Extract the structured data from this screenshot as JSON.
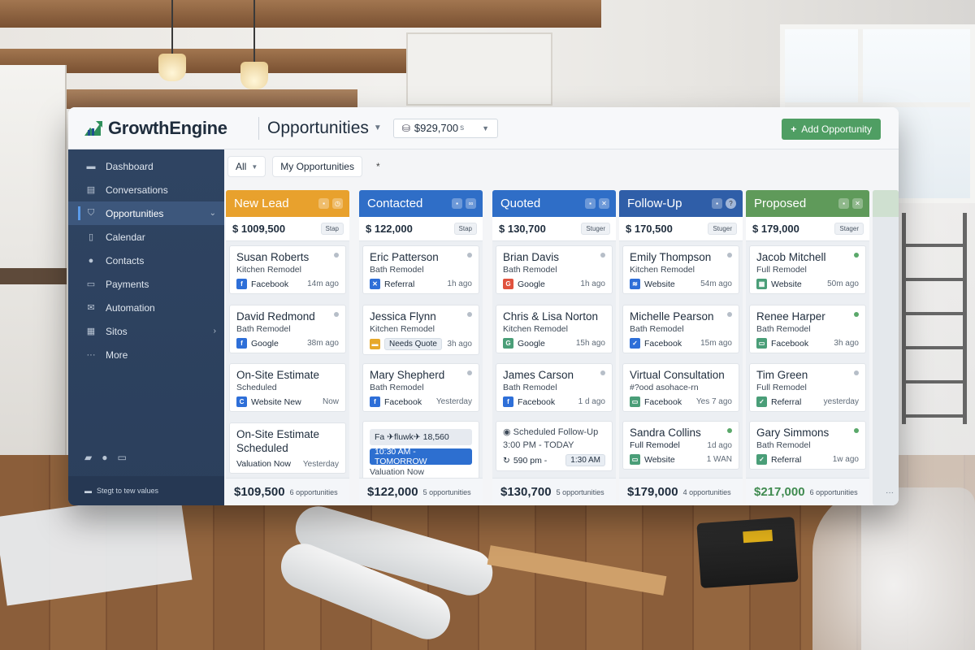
{
  "app": {
    "brand": "GrowthEngine",
    "page_title": "Opportunities",
    "pipeline_total": "$929,700",
    "pipeline_total_suffix": "s",
    "add_button": "Add Opportunity",
    "colors": {
      "accent_green": "#4f9e63",
      "sidebar_bg": "#2f4462",
      "active_blue": "#2d6fd0"
    }
  },
  "sidebar": {
    "items": [
      {
        "label": "Dashboard",
        "icon": "dashboard-icon"
      },
      {
        "label": "Conversations",
        "icon": "chat-icon"
      },
      {
        "label": "Opportunities",
        "icon": "filter-icon",
        "active": true
      },
      {
        "label": "Calendar",
        "icon": "calendar-icon"
      },
      {
        "label": "Contacts",
        "icon": "contacts-icon"
      },
      {
        "label": "Payments",
        "icon": "payments-icon"
      },
      {
        "label": "Automation",
        "icon": "automation-icon"
      },
      {
        "label": "Sitos",
        "icon": "sites-icon"
      },
      {
        "label": "More",
        "icon": "more-icon"
      }
    ],
    "footer": "Stegt to tew values"
  },
  "filters": {
    "all_label": "All",
    "my_label": "My Opportunities",
    "star": "*"
  },
  "columns": [
    {
      "title": "New Lead",
      "color": "#e8a12d",
      "total": "$ 1009,500",
      "stage_label": "Stap",
      "cards": [
        {
          "name": "Susan Roberts",
          "sub": "Kitchen Remodel",
          "source": "Facebook",
          "source_icon": "facebook-icon",
          "source_color": "#2e6fd8",
          "time": "14m ago"
        },
        {
          "name": "David Redmond",
          "sub": "Bath Remodel",
          "source": "Google",
          "source_icon": "facebook-icon",
          "source_color": "#2e6fd8",
          "time": "38m ago"
        },
        {
          "name": "On-Site Estimate",
          "sub": "Scheduled",
          "source": "Website New",
          "source_icon": "website-icon",
          "source_color": "#2e6fd8",
          "time": "Now"
        },
        {
          "name": "On-Site Estimate Scheduled",
          "sub": "",
          "source": "Valuation Now",
          "time": "Yesterday"
        }
      ],
      "footer_total": "$109,500",
      "footer_count": "6 opportunities"
    },
    {
      "title": "Contacted",
      "color": "#2f6ec7",
      "total": "$ 122,000",
      "stage_label": "Stap",
      "cards": [
        {
          "name": "Eric Patterson",
          "sub": "Bath Remodel",
          "source": "Referral",
          "source_icon": "referral-icon",
          "source_color": "#2e6fd8",
          "time": "1h ago"
        },
        {
          "name": "Jessica Flynn",
          "sub": "Kitchen Remodel",
          "source": "Needs Quote",
          "source_icon": "note-icon",
          "source_color": "#e6a82a",
          "time": "3h ago"
        },
        {
          "name": "Mary Shepherd",
          "sub": "Bath Remodel",
          "source": "Facebook",
          "source_icon": "facebook-icon",
          "source_color": "#2e6fd8",
          "time": "Yesterday"
        },
        {
          "name": "Fa ✈fluwk✈ 18,560",
          "time_bar": "10:30 AM - TOMORROW",
          "source": "Valuation Now"
        }
      ],
      "footer_total": "$122,000",
      "footer_count": "5 opportunities"
    },
    {
      "title": "Quoted",
      "color": "#2f6ec7",
      "total": "$ 130,700",
      "stage_label": "Stuger",
      "cards": [
        {
          "name": "Brian Davis",
          "sub": "Bath Remodel",
          "source": "Google",
          "source_icon": "google-icon",
          "source_color": "#e0523e",
          "time": "1h ago"
        },
        {
          "name": "Chris & Lisa Norton",
          "sub": "Kitchen Remodel",
          "source": "Google",
          "source_icon": "google-icon",
          "source_color": "#4a9e78",
          "time": "15h ago"
        },
        {
          "name": "James Carson",
          "sub": "Bath Remodel",
          "source": "Facebook",
          "source_icon": "facebook-icon",
          "source_color": "#2e6fd8",
          "time": "1 d ago"
        },
        {
          "name": "Scheduled Follow-Up",
          "sub": "3:00 PM - TODAY",
          "source": "590 pm -",
          "time_chip": "1:30 AM"
        }
      ],
      "footer_total": "$130,700",
      "footer_count": "5 opportunities"
    },
    {
      "title": "Follow-Up",
      "color": "#2f5ea8",
      "total": "$ 170,500",
      "stage_label": "Stuger",
      "cards": [
        {
          "name": "Emily Thompson",
          "sub": "Kitchen Remodel",
          "source": "Website",
          "source_icon": "website-icon",
          "source_color": "#2e6fd8",
          "time": "54m ago"
        },
        {
          "name": "Michelle Pearson",
          "sub": "Bath Remodel",
          "source": "Facebook",
          "source_icon": "facebook-icon",
          "source_color": "#2e6fd8",
          "time": "15m ago"
        },
        {
          "name": "Virtual Consultation",
          "sub": "#?ood asohace-rn",
          "source": "Facebook",
          "source_icon": "facebook-icon",
          "source_color": "#4a9e78",
          "time": "Yes 7 ago"
        },
        {
          "name": "Sandra Collins",
          "sub": "Full Remodel",
          "source": "Website",
          "source_icon": "website-icon",
          "source_color": "#4a9e78",
          "time": "1 WAN",
          "sub_time": "1d ago"
        }
      ],
      "footer_total": "$179,000",
      "footer_count": "4 opportunities"
    },
    {
      "title": "Proposed",
      "color": "#5f9a5a",
      "total": "$ 179,000",
      "stage_label": "Stager",
      "cards": [
        {
          "name": "Jacob Mitchell",
          "sub": "Full Remodel",
          "source": "Website",
          "source_icon": "website-icon",
          "source_color": "#4a9e78",
          "time": "50m ago"
        },
        {
          "name": "Renee Harper",
          "sub": "Bath Remodel",
          "source": "Facebook",
          "source_icon": "facebook-icon",
          "source_color": "#4a9e78",
          "time": "3h ago"
        },
        {
          "name": "Tim Green",
          "sub": "Full Remodel",
          "source": "Referral",
          "source_icon": "referral-icon",
          "source_color": "#4a9e78",
          "time": "yesterday"
        },
        {
          "name": "Gary Simmons",
          "sub": "Bath Remodel",
          "source": "Referral",
          "source_icon": "referral-icon",
          "source_color": "#4a9e78",
          "time": "1w ago"
        }
      ],
      "footer_total": "$217,000",
      "footer_count": "6 opportunities"
    }
  ]
}
